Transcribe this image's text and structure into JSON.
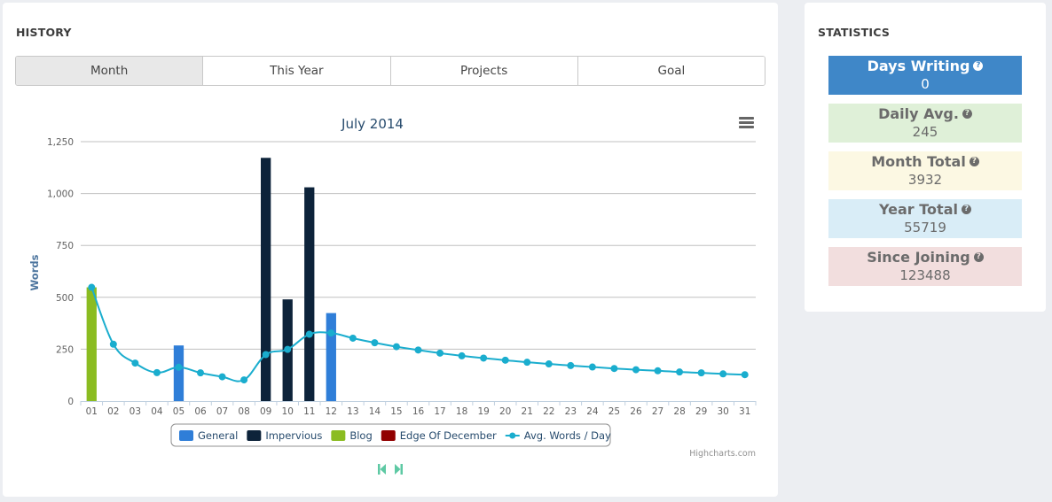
{
  "history": {
    "title": "HISTORY",
    "tabs": [
      {
        "label": "Month",
        "active": true
      },
      {
        "label": "This Year",
        "active": false
      },
      {
        "label": "Projects",
        "active": false
      },
      {
        "label": "Goal",
        "active": false
      }
    ],
    "menu_icon": "hamburger-menu-icon",
    "credits": "Highcharts.com",
    "nav": {
      "prev_icon": "skip-previous-icon",
      "next_icon": "skip-next-icon",
      "color": "#5ec9a4"
    }
  },
  "statistics": {
    "title": "STATISTICS",
    "items": [
      {
        "label": "Days Writing",
        "value": "0",
        "bg": "#3f87c8",
        "fg": "#ffffff",
        "icon": "help-icon"
      },
      {
        "label": "Daily Avg.",
        "value": "245",
        "bg": "#dff0d8",
        "fg": "#6b6b6b",
        "icon": "help-icon"
      },
      {
        "label": "Month Total",
        "value": "3932",
        "bg": "#fcf8e3",
        "fg": "#6b6b6b",
        "icon": "help-icon"
      },
      {
        "label": "Year Total",
        "value": "55719",
        "bg": "#d9edf7",
        "fg": "#6b6b6b",
        "icon": "help-icon"
      },
      {
        "label": "Since Joining",
        "value": "123488",
        "bg": "#f2dede",
        "fg": "#6b6b6b",
        "icon": "help-icon"
      }
    ]
  },
  "chart_data": {
    "type": "bar",
    "title": "July 2014",
    "xlabel": "",
    "ylabel": "Words",
    "ylim": [
      0,
      1250
    ],
    "yticks": [
      0,
      250,
      500,
      750,
      1000,
      1250
    ],
    "ytick_labels": [
      "0",
      "250",
      "500",
      "750",
      "1,000",
      "1,250"
    ],
    "grid": true,
    "legend_position": "bottom-center",
    "categories": [
      "01",
      "02",
      "03",
      "04",
      "05",
      "06",
      "07",
      "08",
      "09",
      "10",
      "11",
      "12",
      "13",
      "14",
      "15",
      "16",
      "17",
      "18",
      "19",
      "20",
      "21",
      "22",
      "23",
      "24",
      "25",
      "26",
      "27",
      "28",
      "29",
      "30",
      "31"
    ],
    "series": [
      {
        "name": "General",
        "type": "bar",
        "color": "#2f7ed8",
        "values": [
          0,
          0,
          0,
          0,
          268,
          0,
          0,
          0,
          0,
          0,
          0,
          424,
          0,
          0,
          0,
          0,
          0,
          0,
          0,
          0,
          0,
          0,
          0,
          0,
          0,
          0,
          0,
          0,
          0,
          0,
          0
        ]
      },
      {
        "name": "Impervious",
        "type": "bar",
        "color": "#0d233a",
        "values": [
          0,
          0,
          0,
          0,
          0,
          0,
          0,
          0,
          1172,
          490,
          1030,
          0,
          0,
          0,
          0,
          0,
          0,
          0,
          0,
          0,
          0,
          0,
          0,
          0,
          0,
          0,
          0,
          0,
          0,
          0,
          0
        ]
      },
      {
        "name": "Blog",
        "type": "bar",
        "color": "#8bbc21",
        "values": [
          548,
          0,
          0,
          0,
          0,
          0,
          0,
          0,
          0,
          0,
          0,
          0,
          0,
          0,
          0,
          0,
          0,
          0,
          0,
          0,
          0,
          0,
          0,
          0,
          0,
          0,
          0,
          0,
          0,
          0,
          0
        ]
      },
      {
        "name": "Edge Of December",
        "type": "bar",
        "color": "#910000",
        "values": [
          0,
          0,
          0,
          0,
          0,
          0,
          0,
          0,
          0,
          0,
          0,
          0,
          0,
          0,
          0,
          0,
          0,
          0,
          0,
          0,
          0,
          0,
          0,
          0,
          0,
          0,
          0,
          0,
          0,
          0,
          0
        ]
      },
      {
        "name": "Avg. Words / Day",
        "type": "line",
        "color": "#1aadce",
        "values": [
          548,
          274,
          183,
          137,
          163,
          136,
          117,
          102,
          224,
          249,
          322,
          328,
          303,
          281,
          262,
          246,
          231,
          218,
          207,
          197,
          187,
          179,
          171,
          164,
          157,
          151,
          146,
          140,
          136,
          131,
          127
        ]
      }
    ]
  }
}
